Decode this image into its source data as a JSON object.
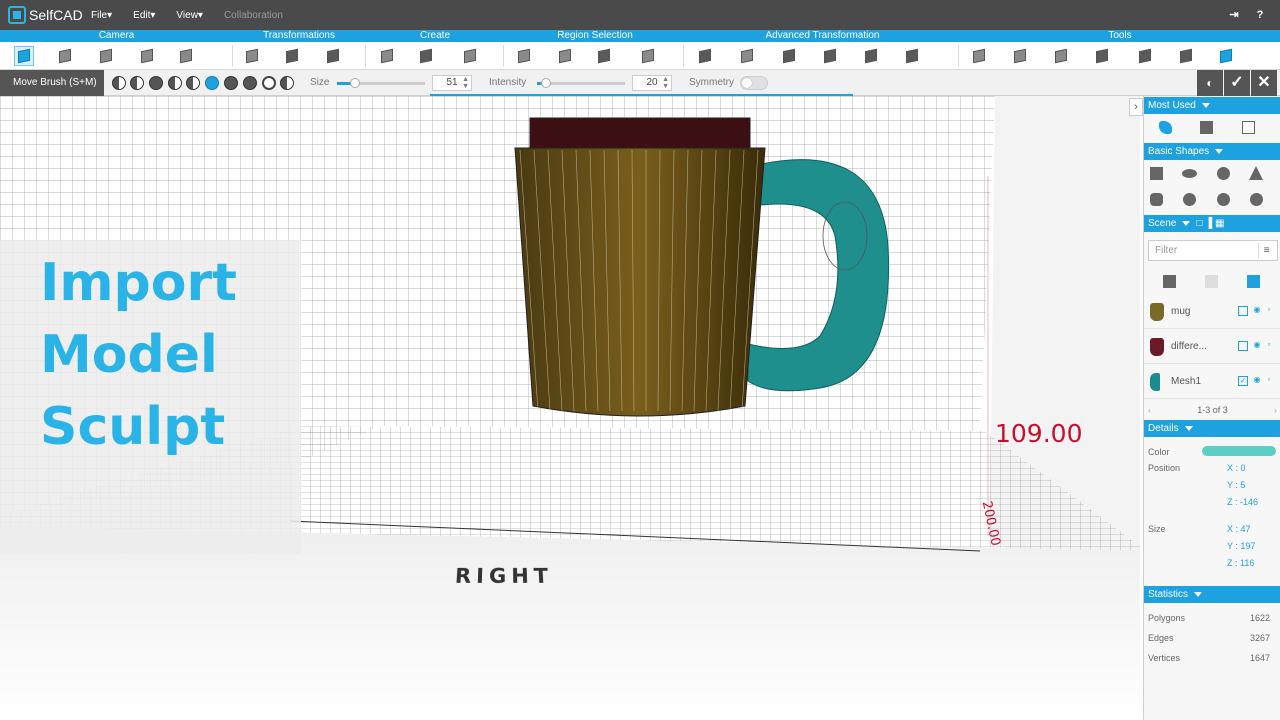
{
  "app": {
    "name": "SelfCAD"
  },
  "menu": [
    {
      "label": "File",
      "caret": "▾"
    },
    {
      "label": "Edit",
      "caret": "▾"
    },
    {
      "label": "View",
      "caret": "▾"
    },
    {
      "label": "Collaboration",
      "caret": ""
    }
  ],
  "categories": [
    "Camera",
    "Transformations",
    "Create",
    "Region Selection",
    "Advanced Transformation",
    "Tools"
  ],
  "sculpt": {
    "mode": "Move Brush (S+M)",
    "size_label": "Size",
    "size_value": "51",
    "size_fraction": 0.2,
    "intensity_label": "Intensity",
    "intensity_value": "20",
    "intensity_fraction": 0.1,
    "symmetry_label": "Symmetry",
    "symmetry_on": false
  },
  "viewport": {
    "overlay": [
      "Import",
      "Model",
      "Sculpt"
    ],
    "dimension": "109.00",
    "dimension_small": "200.00",
    "view_label": "RIGHT"
  },
  "panel": {
    "most_used": "Most Used",
    "basic_shapes": "Basic Shapes",
    "scene": "Scene",
    "filter_placeholder": "Filter",
    "objects": [
      {
        "name": "mug",
        "color": "#7a6a2a"
      },
      {
        "name": "differe...",
        "color": "#6b1a2a"
      },
      {
        "name": "Mesh1",
        "color": "#1a8c8c"
      }
    ],
    "pager": "1-3 of 3",
    "details": "Details",
    "color_label": "Color",
    "color_value": "#5ccfc2",
    "position_label": "Position",
    "position": {
      "x": "X : 0",
      "y": "Y : 5",
      "z": "Z : -146"
    },
    "size_label": "Size",
    "size": {
      "x": "X : 47",
      "y": "Y : 197",
      "z": "Z : 116"
    },
    "statistics": "Statistics",
    "stats": [
      {
        "label": "Polygons",
        "value": "1622"
      },
      {
        "label": "Edges",
        "value": "3267"
      },
      {
        "label": "Vertices",
        "value": "1647"
      }
    ]
  }
}
